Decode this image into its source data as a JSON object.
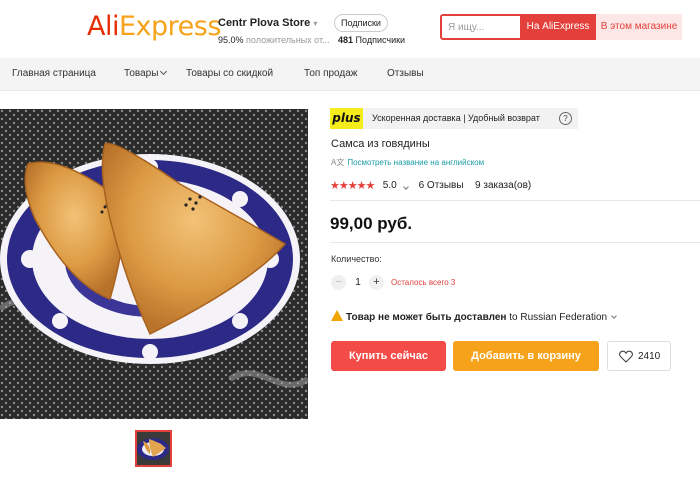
{
  "header": {
    "logo": {
      "part1": "Ali",
      "part2": "Express"
    },
    "store": {
      "name": "Centr Plova Store",
      "rating_value": "95.0%",
      "rating_text": "положительных от...",
      "subscribe_label": "Подписки",
      "subscribers_count": "481",
      "subscribers_label": "Подписчики"
    },
    "search": {
      "placeholder": "Я ищу...",
      "btn_aliexpress": "На AliExpress",
      "btn_store": "В этом магазине"
    }
  },
  "nav": {
    "items": [
      {
        "label": "Главная страница"
      },
      {
        "label": "Товары"
      },
      {
        "label": "Товары со скидкой"
      },
      {
        "label": "Топ продаж"
      },
      {
        "label": "Отзывы"
      }
    ]
  },
  "product": {
    "plus_badge": "plus",
    "plus_text": "Ускоренная доставка | Удобный возврат",
    "help_icon": "?",
    "title": "Самса из говядины",
    "translate_link": "Посмотреть название на английском",
    "stars": "★★★★★",
    "rating": "5.0",
    "reviews": "6 Отзывы",
    "orders": "9 заказа(ов)",
    "price": "99,00 руб.",
    "quantity_label": "Количество:",
    "quantity_value": "1",
    "minus_symbol": "−",
    "plus_symbol": "+",
    "stock_left": "Осталось всего 3",
    "shipping_bold": "Товар не может быть доставлен",
    "shipping_to": "to",
    "shipping_country": "Russian Federation",
    "buy_now": "Купить сейчас",
    "add_to_cart": "Добавить в корзину",
    "wishlist_count": "2410"
  },
  "colors": {
    "accent_red": "#e4403b",
    "buy_red": "#f24b48",
    "cart_orange": "#f7a21b",
    "plus_yellow": "#f5ec1c",
    "link_teal": "#1a9ba5"
  }
}
